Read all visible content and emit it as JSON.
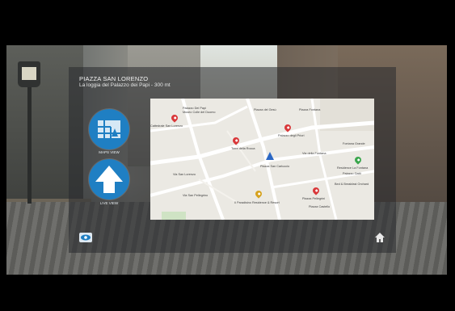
{
  "place": {
    "title": "PIAZZA SAN LORENZO",
    "subtitle": "La loggia del Palazzo dei Papi - 300 mt"
  },
  "nav": {
    "maps_label": "MAPS VIEW",
    "live_label": "LIVE VIEW"
  },
  "map": {
    "labels": [
      "Palazzo Dei Papi",
      "Museo Colle del Duomo",
      "Cattedrale San Lorenzo",
      "Piazza del Gesù",
      "Piazza Fontana",
      "Fontana Grande",
      "Palazzo degli Priori",
      "Torre della Rocca",
      "Piazza San Carluccio",
      "Via della Fontana",
      "Residence La Fontana",
      "Palazzo Gatti",
      "Bed & Breakfast Orchard",
      "Via San Lorenzo",
      "Via San Pellegrino",
      "Piazza Pellegrini",
      "Piazza Castello",
      "Il Paradisino Residence & Resort"
    ],
    "colors": {
      "pin_red": "#d9383a",
      "pin_yellow": "#d6a21e",
      "pin_green": "#3aa64c",
      "you_marker": "#2b67c4"
    }
  },
  "colors": {
    "button_blue": "#1f7fc3",
    "panel": "rgba(40,42,46,0.55)"
  },
  "icons": {
    "map_icon": "map-icon",
    "live_icon": "up-arrow-icon",
    "eye_icon": "eye-icon",
    "home_icon": "home-icon"
  }
}
